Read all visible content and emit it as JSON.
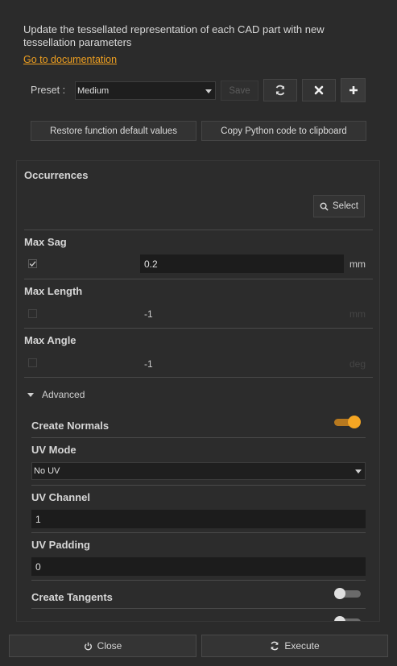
{
  "description": "Update the tessellated representation of each CAD part with new tessellation parameters",
  "doc_link": "Go to documentation",
  "preset": {
    "label": "Preset :",
    "selected": "Medium",
    "save_label": "Save"
  },
  "actions": {
    "restore_label": "Restore function default values",
    "copy_label": "Copy Python code to clipboard"
  },
  "occurrences": {
    "title": "Occurrences",
    "select_label": "Select"
  },
  "max_sag": {
    "title": "Max Sag",
    "checked": true,
    "value": "0.2",
    "unit": "mm"
  },
  "max_length": {
    "title": "Max Length",
    "checked": false,
    "value": "-1",
    "unit": "mm"
  },
  "max_angle": {
    "title": "Max Angle",
    "checked": false,
    "value": "-1",
    "unit": "deg"
  },
  "advanced": {
    "label": "Advanced",
    "expanded": true,
    "create_normals": {
      "title": "Create Normals",
      "on": true
    },
    "uv_mode": {
      "title": "UV Mode",
      "value": "No UV"
    },
    "uv_channel": {
      "title": "UV Channel",
      "value": "1"
    },
    "uv_padding": {
      "title": "UV Padding",
      "value": "0"
    },
    "create_tangents": {
      "title": "Create Tangents",
      "on": false
    },
    "create_free_edges": {
      "on": false
    }
  },
  "footer": {
    "close_label": "Close",
    "execute_label": "Execute"
  },
  "colors": {
    "accent": "#f5a623",
    "link": "#f0a020",
    "background": "#2b2b2b"
  }
}
